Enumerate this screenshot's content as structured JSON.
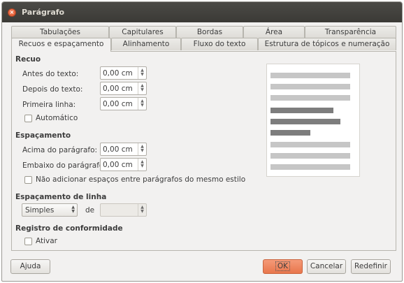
{
  "window": {
    "title": "Parágrafo"
  },
  "tabs_row1": [
    "Tabulações",
    "Capitulares",
    "Bordas",
    "Área",
    "Transparência"
  ],
  "tabs_row2": [
    "Recuos e espaçamento",
    "Alinhamento",
    "Fluxo do texto",
    "Estrutura de tópicos e numeração"
  ],
  "indent": {
    "heading": "Recuo",
    "before_label": "Antes do texto:",
    "before_value": "0,00 cm",
    "after_label": "Depois do texto:",
    "after_value": "0,00 cm",
    "first_label": "Primeira linha:",
    "first_value": "0,00 cm",
    "auto_label": "Automático"
  },
  "spacing": {
    "heading": "Espaçamento",
    "above_label": "Acima do parágrafo:",
    "above_value": "0,00 cm",
    "below_label": "Embaixo do parágrafo:",
    "below_value": "0,00 cm",
    "no_space_label": "Não adicionar espaços entre parágrafos do mesmo estilo"
  },
  "line_spacing": {
    "heading": "Espaçamento de linha",
    "selected": "Simples",
    "of_label": "de",
    "of_value": ""
  },
  "register": {
    "heading": "Registro de conformidade",
    "activate_label": "Ativar"
  },
  "buttons": {
    "help": "Ajuda",
    "ok": "OK",
    "cancel": "Cancelar",
    "reset": "Redefinir"
  },
  "colors": {
    "accent": "#ef8a62",
    "preview_light": "#c6c6c6",
    "preview_dark": "#7d7d7d"
  }
}
